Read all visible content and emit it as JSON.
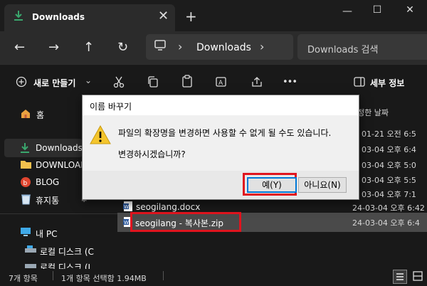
{
  "window": {
    "tab_title": "Downloads",
    "tab_close": "✕",
    "new_tab": "+",
    "controls": {
      "minimize": "—",
      "maximize": "☐",
      "close": "✕"
    }
  },
  "navbar": {
    "back": "←",
    "forward": "→",
    "up": "↑",
    "refresh": "↻",
    "breadcrumb_sep": "›",
    "address": "Downloads",
    "search_placeholder": "Downloads 검색"
  },
  "toolbar": {
    "new_label": "새로 만들기",
    "new_chevron": "⌄",
    "more": "•••",
    "details_label": "세부 정보"
  },
  "sidebar": {
    "items": [
      {
        "label": "홈",
        "icon": "home-icon"
      },
      {
        "label": "Downloads",
        "icon": "download-icon"
      },
      {
        "label": "DOWNLOAD",
        "icon": "folder-icon"
      },
      {
        "label": "BLOG",
        "icon": "blog-icon"
      },
      {
        "label": "휴지통",
        "icon": "recycle-bin-icon"
      },
      {
        "label": "내 PC",
        "icon": "pc-icon"
      },
      {
        "label": "로컬 디스크 (C",
        "icon": "drive-icon"
      },
      {
        "label": "로컬 디스크 (I",
        "icon": "drive-icon"
      }
    ]
  },
  "filelist": {
    "date_header": "정한 날짜",
    "dates": [
      "01-21 오전 6:5",
      "03-04 오후 6:4",
      "03-04 오후 5:0",
      "03-04 오후 5:5",
      "03-04 오후 7:1"
    ],
    "rows": [
      {
        "name": "seogilang.docx",
        "date": "24-03-04 오후 6:42"
      },
      {
        "name": "seogilang - 복사본.zip",
        "date": "24-03-04 오후 6:4"
      }
    ]
  },
  "status": {
    "item_count": "7개 항목",
    "selection": "1개 항목 선택함 1.94MB"
  },
  "dialog": {
    "title": "이름 바꾸기",
    "message": "파일의 확장명을 변경하면 사용할 수 없게 될 수도 있습니다.",
    "question": "변경하시겠습니까?",
    "yes_label": "예(Y)",
    "no_label": "아니요(N)"
  },
  "colors": {
    "highlight": "#e0141e",
    "accent": "#0078d7",
    "download": "#3aa76d"
  }
}
